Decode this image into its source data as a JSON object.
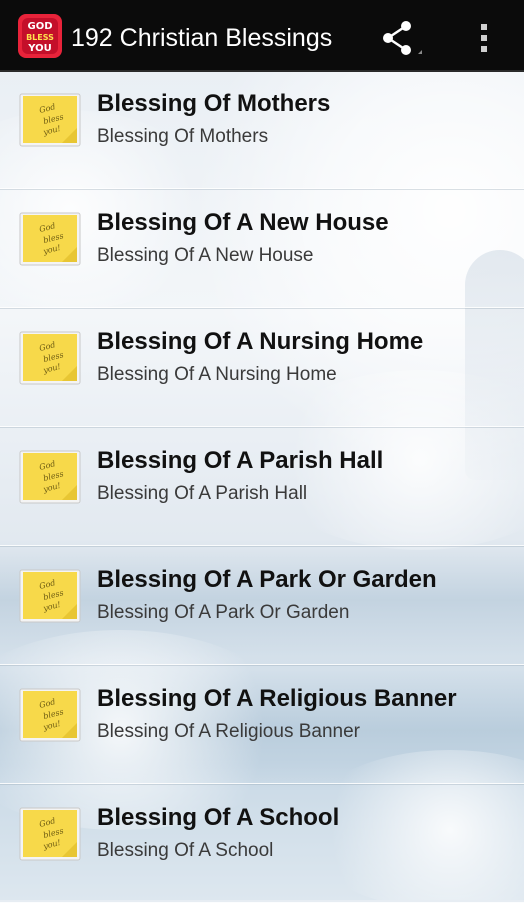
{
  "app": {
    "title": "192 Christian Blessings",
    "logo_text": "GOD BLESS YOU",
    "logo_icon": "god-bless-you-logo",
    "share_icon": "share-icon",
    "overflow_icon": "overflow-menu-icon"
  },
  "thumbnail": {
    "icon": "sticky-note-icon",
    "text": "God bless you!",
    "color": "#f7d94a"
  },
  "colors": {
    "actionbar": "#0b0b0b",
    "title_text": "#111111",
    "subtitle_text": "#3a3a3a"
  },
  "list": {
    "items": [
      {
        "title": "Blessing Of Mothers",
        "subtitle": "Blessing Of Mothers"
      },
      {
        "title": "Blessing Of A New House",
        "subtitle": "Blessing Of A New House"
      },
      {
        "title": "Blessing Of A Nursing Home",
        "subtitle": "Blessing Of A Nursing Home"
      },
      {
        "title": "Blessing Of A Parish Hall",
        "subtitle": "Blessing Of A Parish Hall"
      },
      {
        "title": "Blessing Of A Park Or Garden",
        "subtitle": "Blessing Of A Park Or Garden"
      },
      {
        "title": "Blessing Of A Religious Banner",
        "subtitle": "Blessing Of A Religious Banner"
      },
      {
        "title": "Blessing Of A School",
        "subtitle": "Blessing Of A School"
      }
    ]
  }
}
